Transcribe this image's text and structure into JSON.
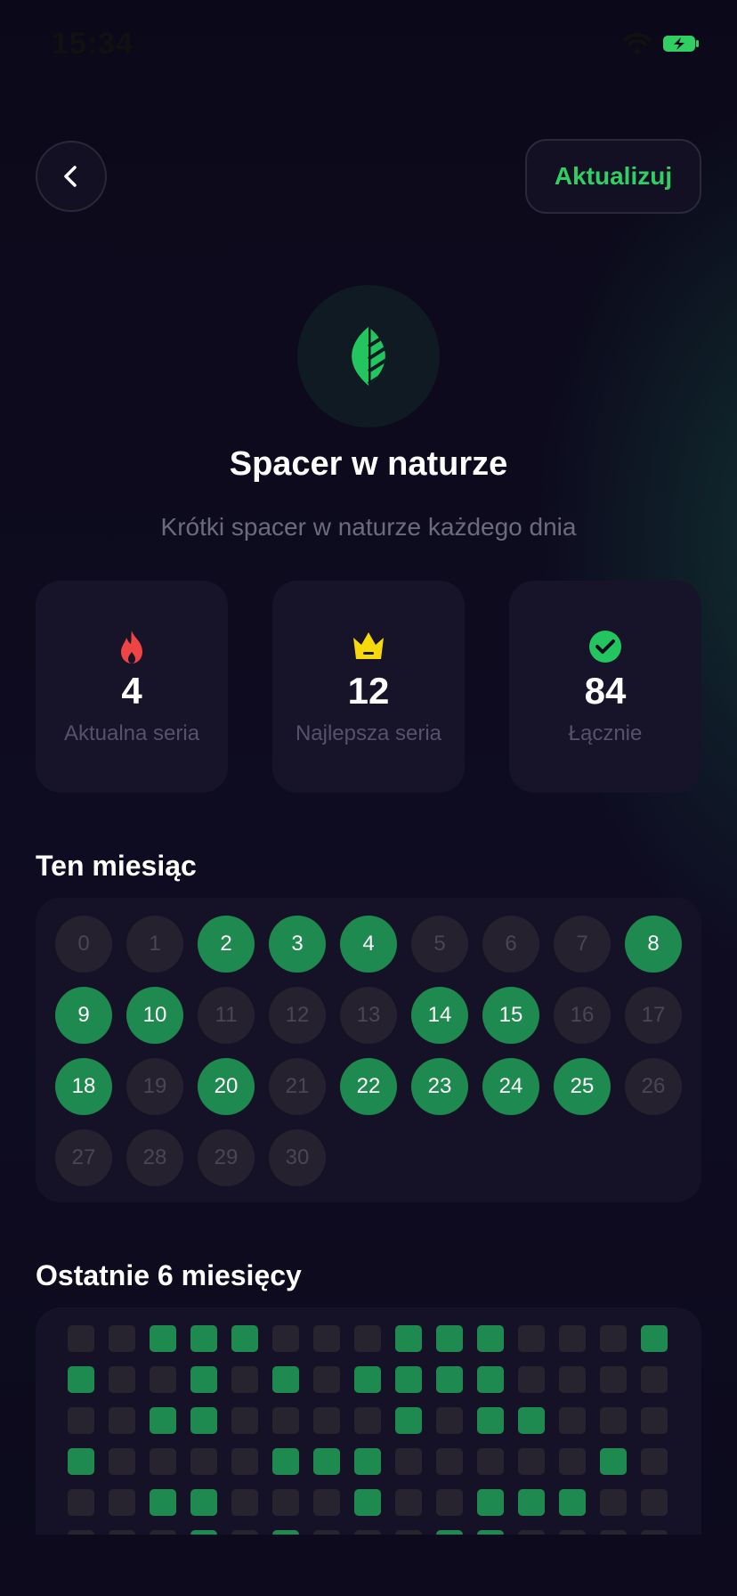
{
  "status_bar": {
    "time": "15:34"
  },
  "header": {
    "back_icon": "chevron-left-icon",
    "update_label": "Aktualizuj"
  },
  "habit": {
    "icon": "leaf-icon",
    "title": "Spacer w naturze",
    "subtitle": "Krótki spacer w naturze każdego dnia"
  },
  "stats": [
    {
      "icon": "flame-icon",
      "value": "4",
      "label": "Aktualna seria",
      "color": "#ef4444"
    },
    {
      "icon": "crown-icon",
      "value": "12",
      "label": "Najlepsza seria",
      "color": "#f5d90a"
    },
    {
      "icon": "check-circle-icon",
      "value": "84",
      "label": "Łącznie",
      "color": "#22c55e"
    }
  ],
  "month": {
    "title": "Ten miesiąc",
    "days": [
      {
        "n": "0",
        "done": false
      },
      {
        "n": "1",
        "done": false
      },
      {
        "n": "2",
        "done": true
      },
      {
        "n": "3",
        "done": true
      },
      {
        "n": "4",
        "done": true
      },
      {
        "n": "5",
        "done": false
      },
      {
        "n": "6",
        "done": false
      },
      {
        "n": "7",
        "done": false
      },
      {
        "n": "8",
        "done": true
      },
      {
        "n": "9",
        "done": true
      },
      {
        "n": "10",
        "done": true
      },
      {
        "n": "11",
        "done": false
      },
      {
        "n": "12",
        "done": false
      },
      {
        "n": "13",
        "done": false
      },
      {
        "n": "14",
        "done": true
      },
      {
        "n": "15",
        "done": true
      },
      {
        "n": "16",
        "done": false
      },
      {
        "n": "17",
        "done": false
      },
      {
        "n": "18",
        "done": true
      },
      {
        "n": "19",
        "done": false
      },
      {
        "n": "20",
        "done": true
      },
      {
        "n": "21",
        "done": false
      },
      {
        "n": "22",
        "done": true
      },
      {
        "n": "23",
        "done": true
      },
      {
        "n": "24",
        "done": true
      },
      {
        "n": "25",
        "done": true
      },
      {
        "n": "26",
        "done": false
      },
      {
        "n": "27",
        "done": false
      },
      {
        "n": "28",
        "done": false
      },
      {
        "n": "29",
        "done": false
      },
      {
        "n": "30",
        "done": false
      }
    ]
  },
  "six_months": {
    "title": "Ostatnie 6 miesięcy",
    "rows": [
      [
        0,
        0,
        1,
        1,
        1,
        0,
        0,
        0,
        1,
        1,
        1,
        0,
        0,
        0,
        1
      ],
      [
        1,
        0,
        0,
        1,
        0,
        1,
        0,
        1,
        1,
        1,
        1,
        0,
        0,
        0,
        0
      ],
      [
        0,
        0,
        1,
        1,
        0,
        0,
        0,
        0,
        1,
        0,
        1,
        1,
        0,
        0,
        0
      ],
      [
        1,
        0,
        0,
        0,
        0,
        1,
        1,
        1,
        0,
        0,
        0,
        0,
        0,
        1,
        0
      ],
      [
        0,
        0,
        1,
        1,
        0,
        0,
        0,
        1,
        0,
        0,
        1,
        1,
        1,
        0,
        0
      ],
      [
        0,
        0,
        0,
        1,
        0,
        1,
        0,
        0,
        0,
        1,
        1,
        0,
        0,
        0,
        0
      ]
    ]
  },
  "colors": {
    "accent": "#2fcf64",
    "done": "#1f8a4f",
    "background": "#0c0a1d"
  }
}
